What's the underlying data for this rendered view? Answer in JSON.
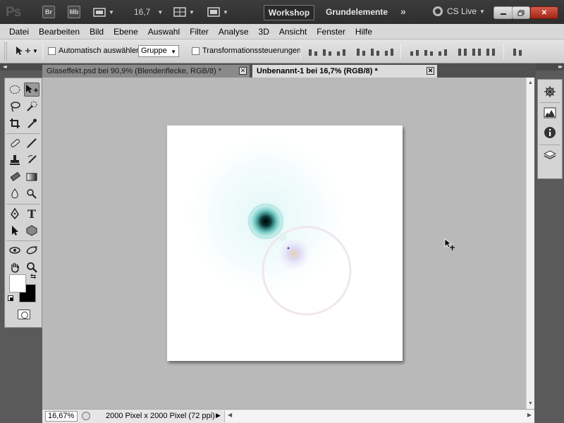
{
  "appbar": {
    "logo": "Ps",
    "bridge_label": "Br",
    "minibridge_label": "Mb",
    "zoom_value": "16,7",
    "workspace_button": "Workshop",
    "workspace_name": "Grundelemente",
    "more_label": "»",
    "cslive_label": "CS Live"
  },
  "menubar": {
    "items": [
      "Datei",
      "Bearbeiten",
      "Bild",
      "Ebene",
      "Auswahl",
      "Filter",
      "Analyse",
      "3D",
      "Ansicht",
      "Fenster",
      "Hilfe"
    ]
  },
  "options": {
    "auto_select_label": "Automatisch auswählen:",
    "auto_select_value": "Gruppe",
    "transform_label": "Transformationssteuerungen"
  },
  "tabs": [
    {
      "label": "Glaseffekt.psd bei 90,9% (Blendenflecke, RGB/8) *",
      "active": false
    },
    {
      "label": "Unbenannt-1 bei 16,7% (RGB/8) *",
      "active": true
    }
  ],
  "status": {
    "zoom": "16,67%",
    "doc_info": "2000 Pixel x 2000 Pixel (72 ppi)"
  },
  "colors": {
    "foreground": "#ffffff",
    "background": "#000000",
    "canvas_bg": "#b9b9b9"
  },
  "tools": [
    "marquee-tool",
    "move-tool",
    "lasso-tool",
    "quick-selection-tool",
    "crop-tool",
    "eyedropper-tool",
    "healing-brush-tool",
    "brush-tool",
    "clone-stamp-tool",
    "history-brush-tool",
    "eraser-tool",
    "gradient-tool",
    "blur-tool",
    "dodge-tool",
    "pen-tool",
    "type-tool",
    "path-selection-tool",
    "shape-tool",
    "3d-rotate-tool",
    "3d-orbit-tool",
    "hand-tool",
    "zoom-tool"
  ]
}
